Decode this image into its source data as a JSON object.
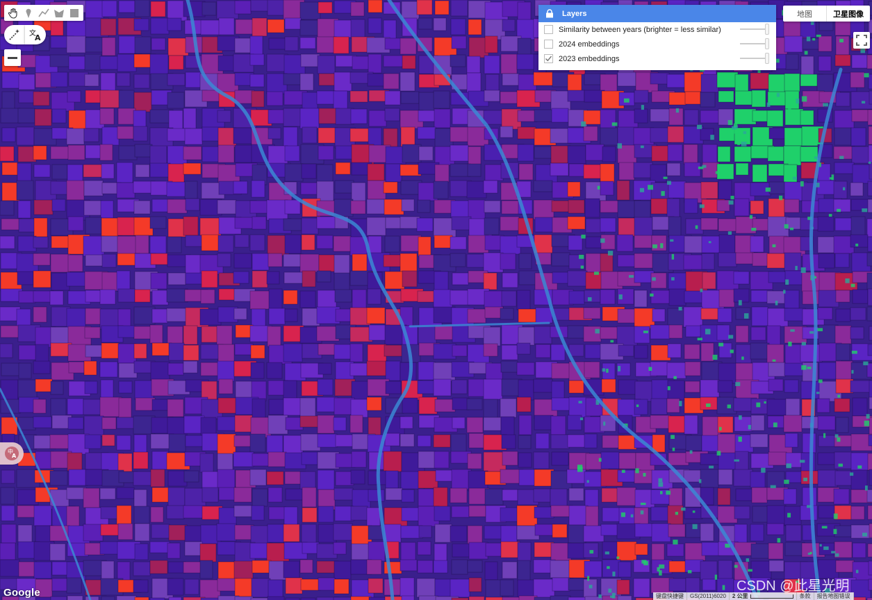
{
  "toolbar": {
    "tools": [
      "hand-icon",
      "marker-icon",
      "polyline-icon",
      "polygon-icon",
      "rectangle-icon"
    ]
  },
  "controls": {
    "magic": "magic-wand-icon",
    "translate": "translate-icon",
    "zoom_out": "zoom-out-icon",
    "fullscreen": "fullscreen-icon"
  },
  "layers": {
    "title": "Layers",
    "items": [
      {
        "label": "Similarity between years (brighter = less similar)",
        "checked": false
      },
      {
        "label": "2024 embeddings",
        "checked": false
      },
      {
        "label": "2023 embeddings",
        "checked": true
      }
    ]
  },
  "map_type": {
    "map_label": "地图",
    "satellite_label": "卫星图像",
    "selected": "satellite"
  },
  "footer": {
    "logo": "Google",
    "keyboard": "键盘快捷键",
    "data": "GS(2011)6020",
    "scale": "2 公里",
    "terms": "条款",
    "report": "报告地图错误",
    "watermark": "CSDN @此星光明"
  },
  "colors": {
    "base": "#3a1f8c",
    "field_purple": "#5522c0",
    "field_red": "#d8234e",
    "field_bright_red": "#f43a28",
    "field_magenta": "#8a2a9a",
    "field_green": "#1fd06a",
    "river": "#3a8fd8",
    "layers_header": "#4a86e8"
  }
}
